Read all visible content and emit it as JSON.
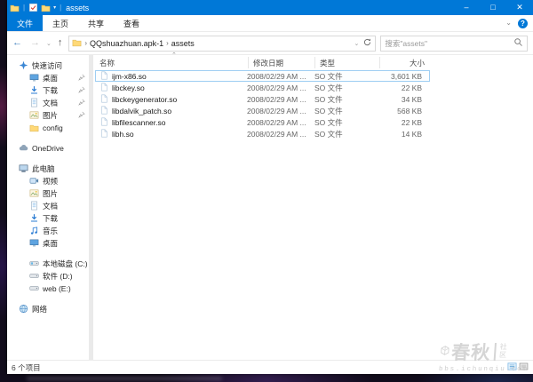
{
  "window": {
    "title": "assets"
  },
  "titlebar": {
    "quick_access_icons": [
      "explorer-folder",
      "properties-check",
      "new-folder"
    ],
    "controls": {
      "minimize": "–",
      "maximize": "□",
      "close": "✕"
    }
  },
  "ribbon": {
    "tabs": [
      {
        "id": "file",
        "label": "文件",
        "active": true
      },
      {
        "id": "home",
        "label": "主页",
        "active": false
      },
      {
        "id": "share",
        "label": "共享",
        "active": false
      },
      {
        "id": "view",
        "label": "查看",
        "active": false
      }
    ],
    "help_label": "?"
  },
  "addressbar": {
    "breadcrumb": [
      "QQshuazhuan.apk-1",
      "assets"
    ],
    "search_placeholder": "搜索\"assets\""
  },
  "sidebar": {
    "sections": [
      {
        "id": "quick-access",
        "label": "快速访问",
        "icon": "star",
        "gap": false,
        "items": [
          {
            "id": "desktop",
            "label": "桌面",
            "icon": "desktop",
            "pinned": true
          },
          {
            "id": "downloads",
            "label": "下载",
            "icon": "download",
            "pinned": true
          },
          {
            "id": "documents",
            "label": "文档",
            "icon": "document",
            "pinned": true
          },
          {
            "id": "pictures",
            "label": "图片",
            "icon": "picture",
            "pinned": true
          },
          {
            "id": "config",
            "label": "config",
            "icon": "folder",
            "pinned": false
          }
        ]
      },
      {
        "id": "onedrive",
        "label": "OneDrive",
        "icon": "cloud",
        "gap": true,
        "items": []
      },
      {
        "id": "this-pc",
        "label": "此电脑",
        "icon": "pc",
        "gap": true,
        "items": [
          {
            "id": "videos",
            "label": "视频",
            "icon": "video",
            "pinned": false
          },
          {
            "id": "pictures-pc",
            "label": "图片",
            "icon": "picture",
            "pinned": false
          },
          {
            "id": "documents-pc",
            "label": "文档",
            "icon": "document",
            "pinned": false
          },
          {
            "id": "downloads-pc",
            "label": "下载",
            "icon": "download",
            "pinned": false
          },
          {
            "id": "music",
            "label": "音乐",
            "icon": "music",
            "pinned": false
          },
          {
            "id": "desktop-pc",
            "label": "桌面",
            "icon": "desktop",
            "pinned": false
          },
          {
            "id": "disk-c",
            "label": "本地磁盘 (C:)",
            "icon": "drive-c",
            "pinned": false,
            "gap": true
          },
          {
            "id": "disk-d",
            "label": "软件 (D:)",
            "icon": "drive",
            "pinned": false
          },
          {
            "id": "disk-e",
            "label": "web (E:)",
            "icon": "drive",
            "pinned": false
          }
        ]
      },
      {
        "id": "network",
        "label": "网络",
        "icon": "network",
        "gap": true,
        "items": []
      }
    ]
  },
  "files": {
    "columns": [
      "名称",
      "修改日期",
      "类型",
      "大小"
    ],
    "rows": [
      {
        "name": "ijm-x86.so",
        "date": "2008/02/29 AM ...",
        "type": "SO 文件",
        "size": "3,601 KB",
        "selected": true
      },
      {
        "name": "libckey.so",
        "date": "2008/02/29 AM ...",
        "type": "SO 文件",
        "size": "22 KB",
        "selected": false
      },
      {
        "name": "libckeygenerator.so",
        "date": "2008/02/29 AM ...",
        "type": "SO 文件",
        "size": "34 KB",
        "selected": false
      },
      {
        "name": "libdalvik_patch.so",
        "date": "2008/02/29 AM ...",
        "type": "SO 文件",
        "size": "568 KB",
        "selected": false
      },
      {
        "name": "libfilescanner.so",
        "date": "2008/02/29 AM ...",
        "type": "SO 文件",
        "size": "22 KB",
        "selected": false
      },
      {
        "name": "libh.so",
        "date": "2008/02/29 AM ...",
        "type": "SO 文件",
        "size": "14 KB",
        "selected": false
      }
    ]
  },
  "statusbar": {
    "items_text": "6 个项目"
  },
  "watermark": {
    "logo_text": "春秋",
    "suffix": "社区",
    "url": "bbs.ichunqiu.com"
  },
  "colors": {
    "accent": "#0078d7",
    "selection_border": "#9ecef2",
    "folder": "#ffd977"
  }
}
